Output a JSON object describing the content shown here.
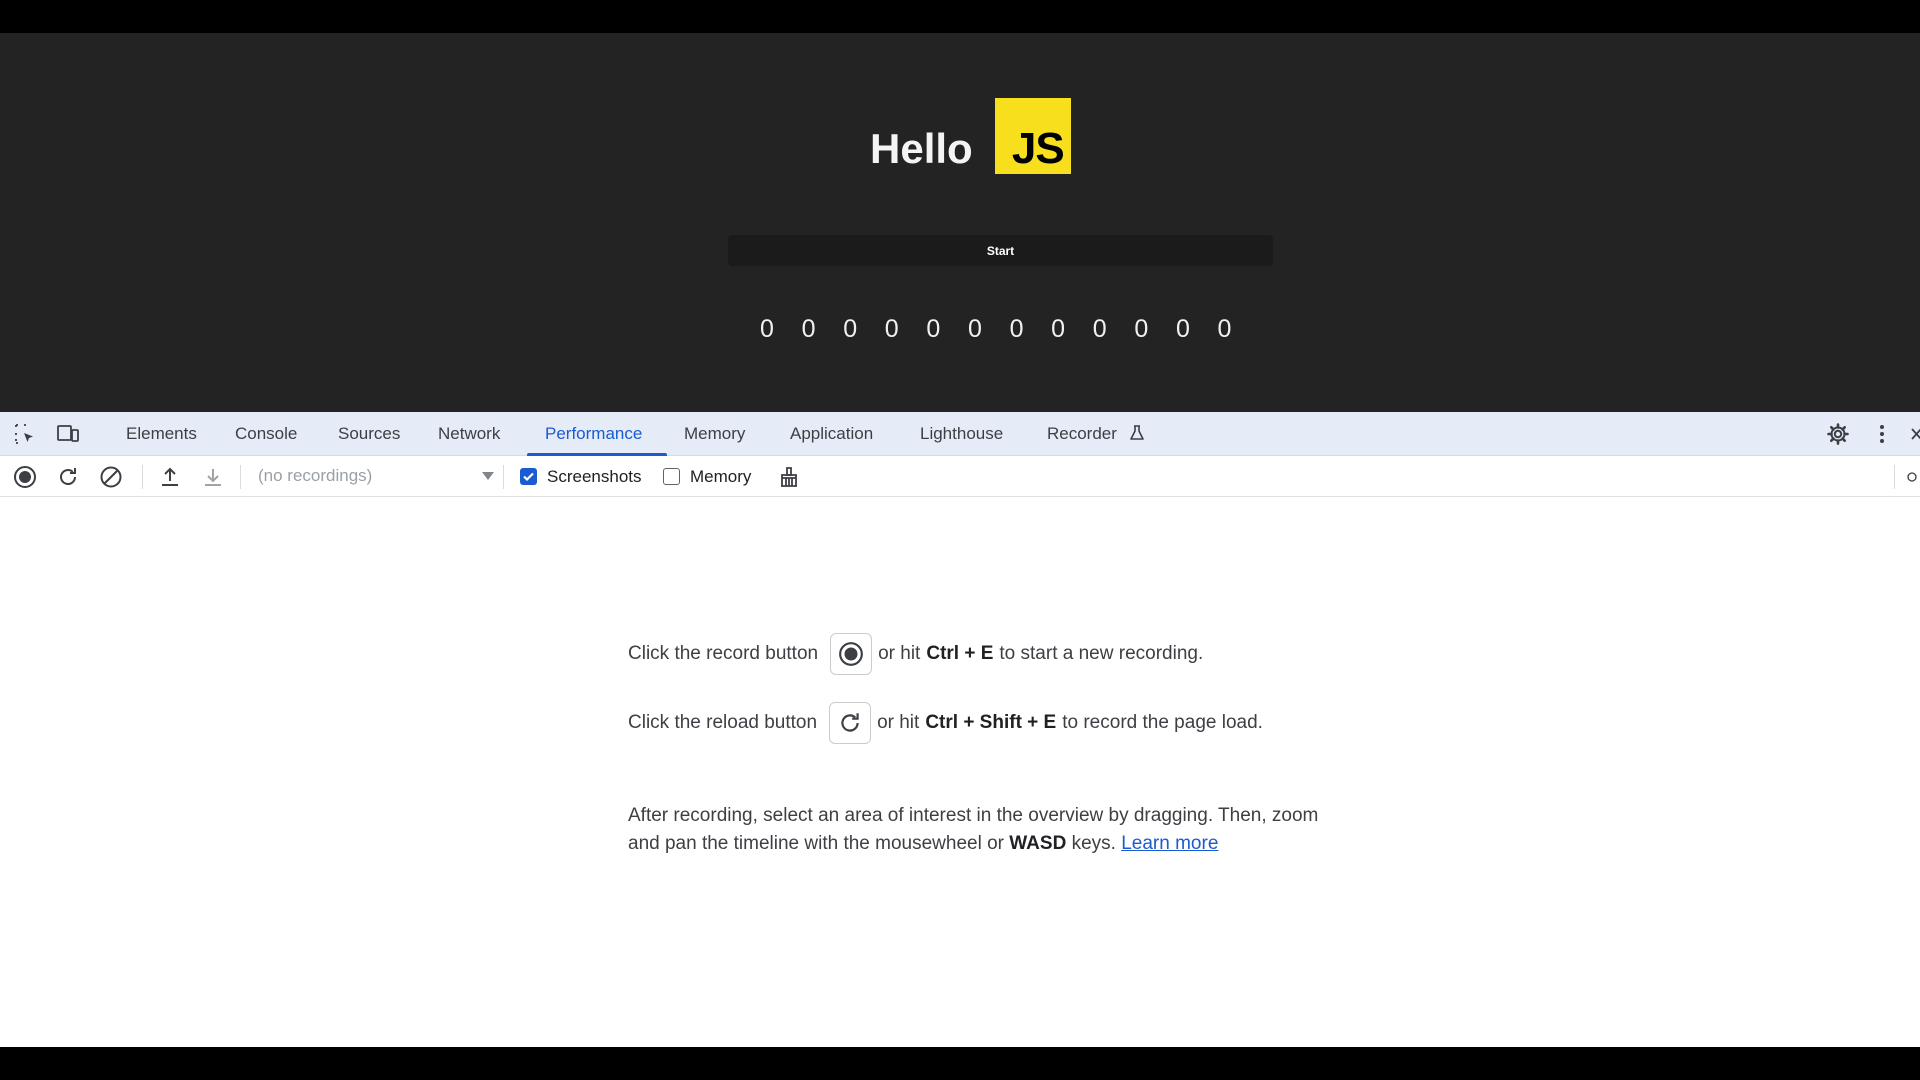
{
  "page": {
    "hello": "Hello",
    "logo_text": "JS",
    "start_label": "Start",
    "digits": [
      "0",
      "0",
      "0",
      "0",
      "0",
      "0",
      "0",
      "0",
      "0",
      "0",
      "0",
      "0"
    ]
  },
  "devtools": {
    "tabs": [
      {
        "label": "Elements"
      },
      {
        "label": "Console"
      },
      {
        "label": "Sources"
      },
      {
        "label": "Network"
      },
      {
        "label": "Performance",
        "active": true
      },
      {
        "label": "Memory"
      },
      {
        "label": "Application"
      },
      {
        "label": "Lighthouse"
      },
      {
        "label": "Recorder"
      }
    ],
    "toolbar": {
      "recordings_placeholder": "(no recordings)",
      "screenshots_label": "Screenshots",
      "screenshots_checked": true,
      "memory_label": "Memory",
      "memory_checked": false
    },
    "help": {
      "record_prefix": "Click the record button",
      "record_or_hit": "or hit",
      "record_shortcut": "Ctrl + E",
      "record_suffix": "to start a new recording.",
      "reload_prefix": "Click the reload button",
      "reload_or_hit": "or hit",
      "reload_shortcut": "Ctrl + Shift + E",
      "reload_suffix": "to record the page load.",
      "para_part1": "After recording, select an area of interest in the overview by dragging. Then, zoom and pan the timeline with the mousewheel or",
      "para_keys": "WASD",
      "para_part2": "keys.",
      "learn_more": "Learn more"
    }
  }
}
